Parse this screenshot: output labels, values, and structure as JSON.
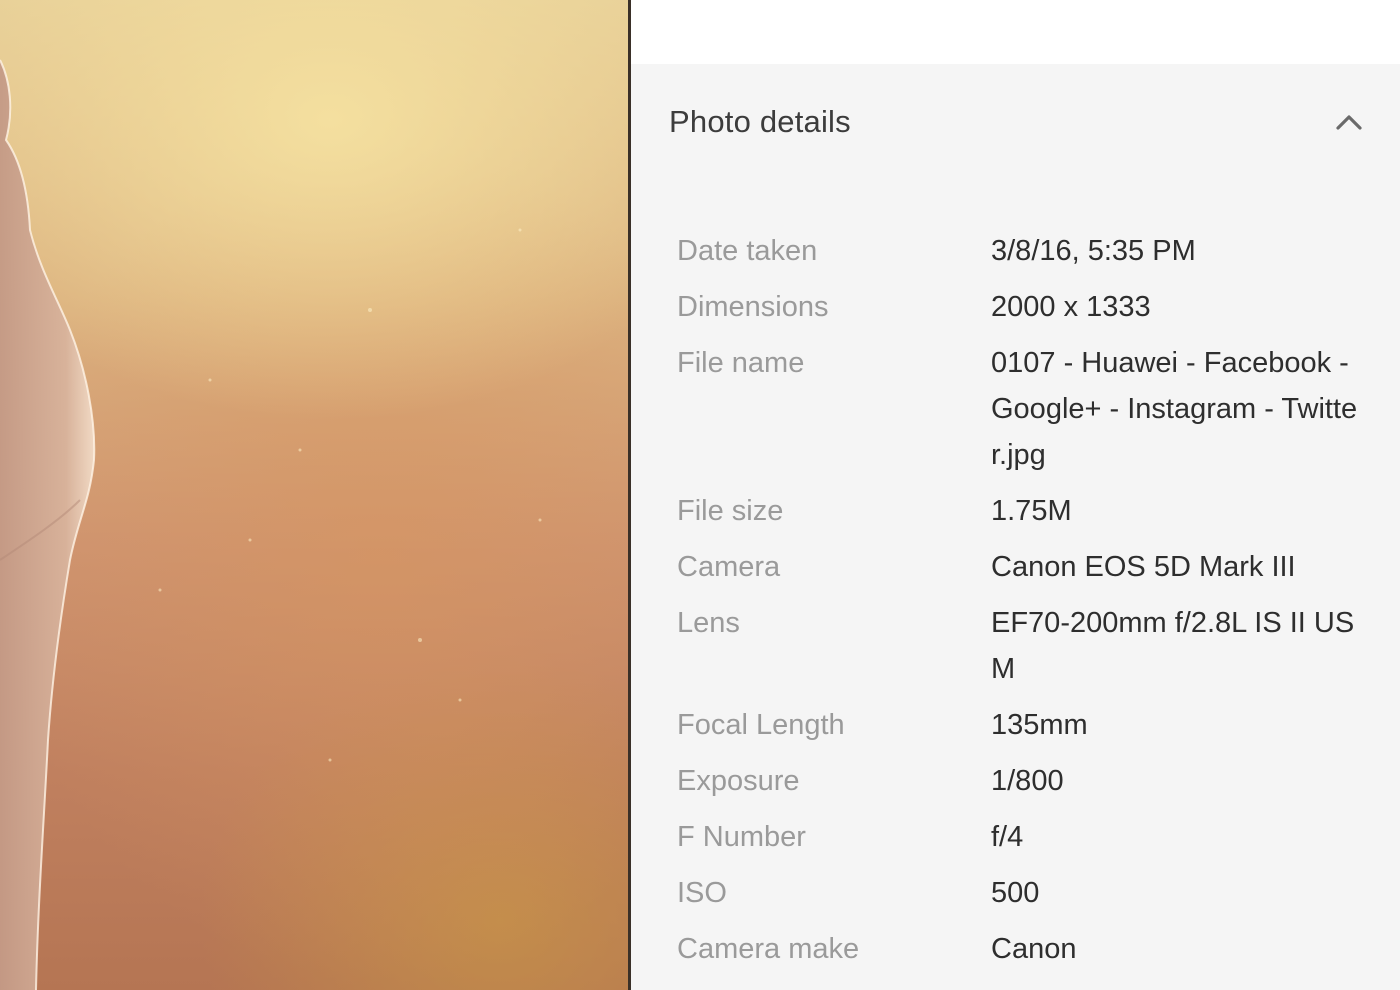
{
  "panel": {
    "title": "Photo details",
    "collapse_icon": "chevron-up-icon"
  },
  "details": [
    {
      "label": "Date taken",
      "value": "3/8/16, 5:35 PM"
    },
    {
      "label": "Dimensions",
      "value": "2000 x 1333"
    },
    {
      "label": "File name",
      "value": "0107 - Huawei - Facebook - Google+ - Instagram - Twitter.jpg"
    },
    {
      "label": "File size",
      "value": "1.75M"
    },
    {
      "label": "Camera",
      "value": "Canon EOS 5D Mark III"
    },
    {
      "label": "Lens",
      "value": "EF70-200mm f/2.8L IS II USM"
    },
    {
      "label": "Focal Length",
      "value": "135mm"
    },
    {
      "label": "Exposure",
      "value": "1/800"
    },
    {
      "label": "F Number",
      "value": "f/4"
    },
    {
      "label": "ISO",
      "value": "500"
    },
    {
      "label": "Camera make",
      "value": "Canon"
    }
  ],
  "colors": {
    "panel_bg": "#f5f5f5",
    "label": "#9a9a9a",
    "value": "#2e2e2e",
    "title": "#3c3c3c"
  }
}
